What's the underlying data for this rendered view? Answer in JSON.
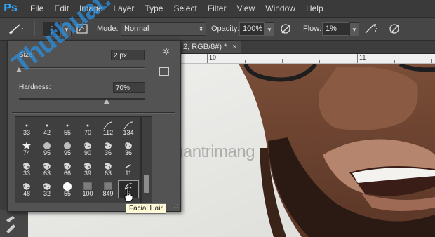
{
  "menubar": {
    "logo": "Ps",
    "items": [
      "File",
      "Edit",
      "Image",
      "Layer",
      "Type",
      "Select",
      "Filter",
      "View",
      "Window",
      "Help"
    ]
  },
  "options": {
    "brush_size_top": "·",
    "brush_size_value": "2",
    "mode_label": "Mode:",
    "mode_value": "Normal",
    "opacity_label": "Opacity:",
    "opacity_value": "100%",
    "flow_label": "Flow:",
    "flow_value": "1%"
  },
  "document": {
    "tab_title": "2, RGB/8#) *",
    "tab_close": "×",
    "ruler_numbers": [
      "10",
      "11"
    ]
  },
  "brush_panel": {
    "size_label": "Size:",
    "size_value": "2 px",
    "size_level": 0.02,
    "hardness_label": "Hardness:",
    "hardness_value": "70%",
    "hardness_level": 0.7,
    "presets": [
      [
        "33",
        "42",
        "55",
        "70",
        "112",
        "134"
      ],
      [
        "74",
        "95",
        "95",
        "90",
        "36",
        "36"
      ],
      [
        "33",
        "63",
        "66",
        "39",
        "63",
        "11"
      ],
      [
        "48",
        "32",
        "55",
        "100",
        "849",
        "5"
      ]
    ],
    "selected_preset": "5"
  },
  "tooltip": "Facial Hair",
  "watermark": {
    "text": "uantrimang",
    "stamp": "Thuthuat.Tips"
  },
  "colors": {
    "accent": "#31a8ff",
    "panel": "#535353",
    "menubar": "#3a3a3a"
  }
}
